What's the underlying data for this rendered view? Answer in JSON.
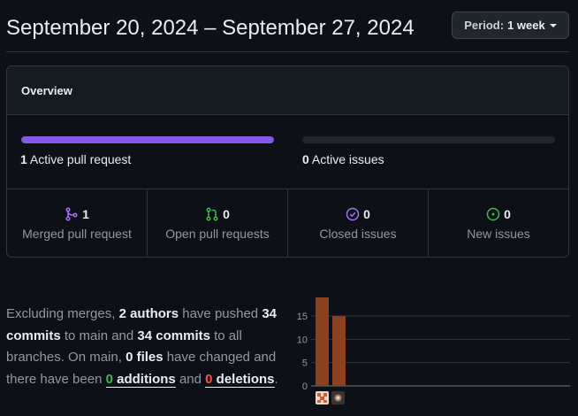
{
  "header": {
    "title": "September 20, 2024 – September 27, 2024",
    "period_label": "Period:",
    "period_value": "1 week"
  },
  "overview": {
    "title": "Overview",
    "pull_requests_progress": 1.0,
    "issues_progress": 0.0,
    "active_pr_count": "1",
    "active_pr_label": "Active pull request",
    "active_issues_count": "0",
    "active_issues_label": "Active issues",
    "stats": [
      {
        "value": "1",
        "label": "Merged pull request",
        "icon": "git-merge-icon",
        "color": "#a371f7"
      },
      {
        "value": "0",
        "label": "Open pull requests",
        "icon": "git-pull-request-icon",
        "color": "#3fb950"
      },
      {
        "value": "0",
        "label": "Closed issues",
        "icon": "issue-closed-icon",
        "color": "#a371f7"
      },
      {
        "value": "0",
        "label": "New issues",
        "icon": "issue-opened-icon",
        "color": "#3fb950"
      }
    ]
  },
  "summary": {
    "t1": "Excluding merges, ",
    "authors": "2 authors",
    "t2": " have pushed ",
    "commits1": "34 commits",
    "t3": " to main and ",
    "commits2": "34 commits",
    "t4": " to all branches. On main, ",
    "files": "0 files",
    "t5": " have changed and there have been ",
    "additions_count": "0",
    "additions_label": " additions",
    "t6": " and ",
    "deletions_count": "0",
    "deletions_label": " deletions",
    "t7": "."
  },
  "chart_data": {
    "type": "bar",
    "categories": [
      "author 1",
      "author 2"
    ],
    "values": [
      19,
      15
    ],
    "ylim": [
      0,
      19
    ],
    "yticks": [
      "0",
      "5",
      "10",
      "15"
    ],
    "bar_color": "#8b4120",
    "grid": true
  }
}
